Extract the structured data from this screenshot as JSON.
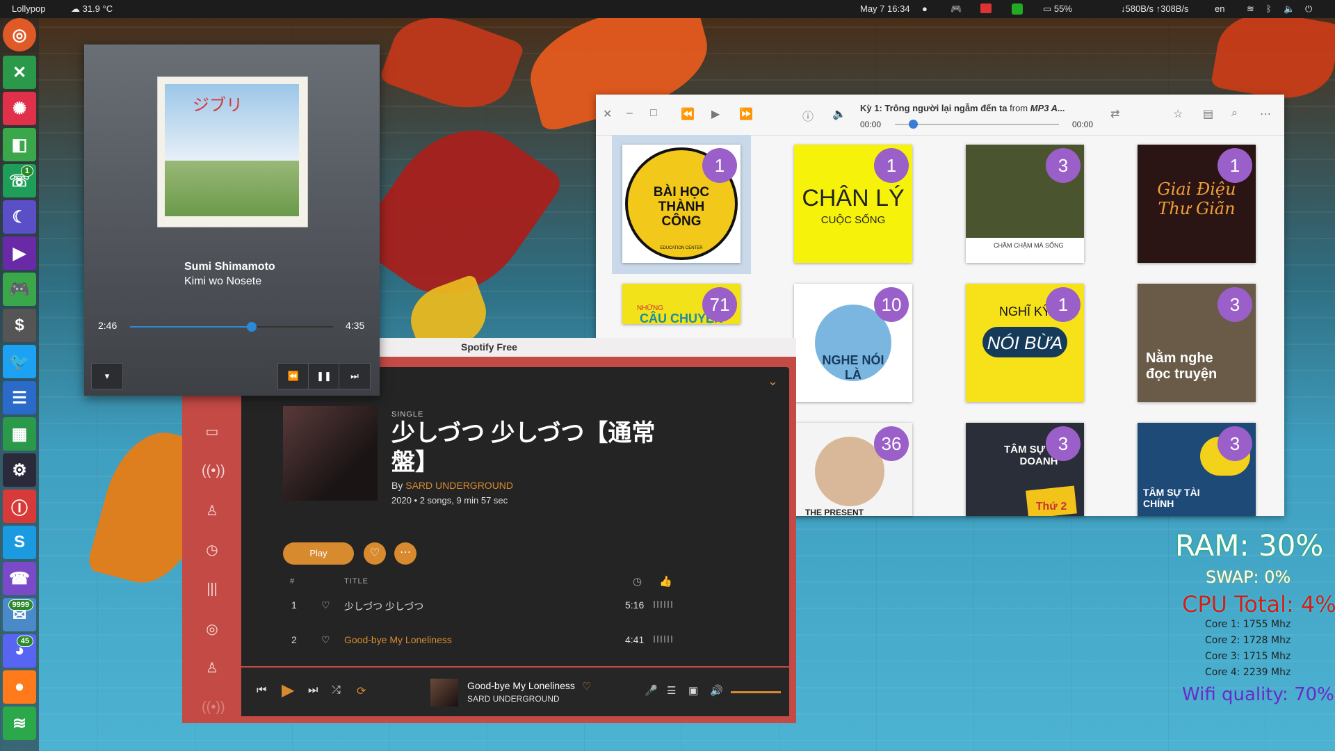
{
  "topbar": {
    "user": "Lollypop",
    "weather": "☁ 31.9 °C",
    "datetime": "May 7  16:34",
    "battery": "55%",
    "network": "↓580B/s ↑308B/s",
    "lang": "en"
  },
  "dock": {
    "badges": {
      "phone_app": "1",
      "chat_app": "9999",
      "discord": "45"
    }
  },
  "mini_player": {
    "artist": "Sumi Shimamoto",
    "track": "Kimi wo Nosete",
    "elapsed": "2:46",
    "duration": "4:35",
    "progress_fraction": 0.6,
    "album_art_text": "ジブリ"
  },
  "podcasts": {
    "now_playing_title": "Kỳ 1: Trông người lại ngẫm đến ta",
    "now_playing_from": "from",
    "now_playing_source": "MP3 A...",
    "time_start": "00:00",
    "time_end": "00:00",
    "tiles": [
      {
        "label": "BÀI HỌC THÀNH CÔNG",
        "sub": "EDUCATION CENTER",
        "count": "1"
      },
      {
        "label": "CHÂN LÝ",
        "sub": "CUỘC SỐNG",
        "count": "1"
      },
      {
        "label": "CHẦM CHẬM MÀ SỐNG",
        "sub": "",
        "count": "3"
      },
      {
        "label": "Giai Điệu Thư Giãn",
        "sub": "",
        "count": "1"
      },
      {
        "label": "CÂU CHUYỆN",
        "sub": "NHỮNG",
        "count": "71"
      },
      {
        "label": "NGHE NÓI LÀ",
        "sub": "",
        "count": "10"
      },
      {
        "label": "NÓI BỪA",
        "sub": "NGHĨ KỸ",
        "count": "1"
      },
      {
        "label": "Nằm nghe đọc truyện",
        "sub": "",
        "count": "3"
      },
      {
        "label": "THE PRESENT",
        "sub": "",
        "count": "36"
      },
      {
        "label": "TÂM SỰ KINH DOANH",
        "sub": "Thứ 2",
        "count": "3"
      },
      {
        "label": "TÂM SỰ TÀI CHÍNH",
        "sub": "",
        "count": "3"
      }
    ]
  },
  "spotify": {
    "window_title": "Spotify Free",
    "album_type": "SINGLE",
    "album_title": "少しづつ 少しづつ【通常盤】",
    "by": "By",
    "artist": "SARD UNDERGROUND",
    "meta": "2020 • 2 songs, 9 min 57 sec",
    "play_label": "Play",
    "col_num": "#",
    "col_title": "TITLE",
    "tracks": [
      {
        "num": "1",
        "title": "少しづつ 少しづつ",
        "duration": "5:16"
      },
      {
        "num": "2",
        "title": "Good-bye My Loneliness",
        "duration": "4:41"
      }
    ],
    "now_playing": {
      "title": "Good-bye My Loneliness",
      "artist": "SARD UNDERGROUND"
    },
    "volume_fraction": 1.0,
    "accent": "#d88a2e"
  },
  "conky": {
    "ram": "RAM: 30%",
    "swap": "SWAP: 0%",
    "cpu": "CPU Total: 4%",
    "cores": [
      "Core 1: 1755 Mhz",
      "Core 2: 1728 Mhz",
      "Core 3: 1715 Mhz",
      "Core 4: 2239 Mhz"
    ],
    "wifi": "Wifi quality: 70%"
  }
}
